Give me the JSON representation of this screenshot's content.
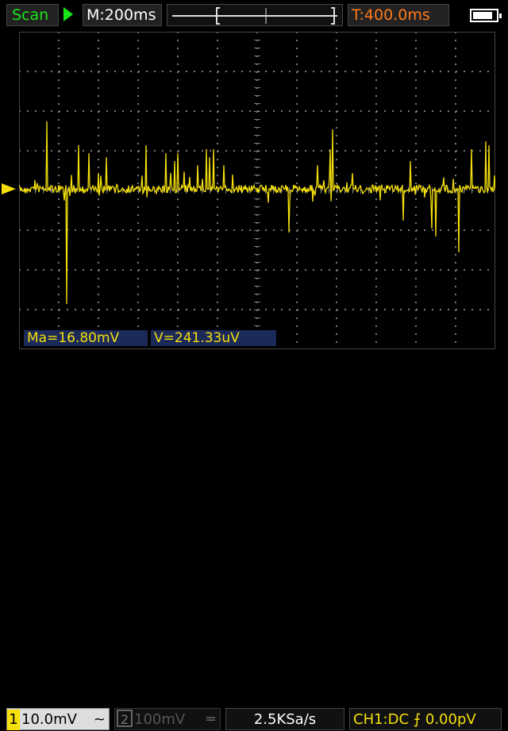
{
  "status_bar": {
    "mode": "Scan",
    "run_icon": "play-icon",
    "timebase": "M:200ms",
    "trigger_time": "T:400.0ms",
    "battery_icon": "battery-icon"
  },
  "colors": {
    "ch1": "#f5e00a",
    "run": "#19e619",
    "trigger_time": "#ff7a1a",
    "grid": "#7a7a7a"
  },
  "measurements": {
    "ma": "Ma=16.80mV",
    "v": "V=241.33uV"
  },
  "channels": {
    "ch1": {
      "number": "1",
      "scale": "10.0mV",
      "coupling": "~"
    },
    "ch2": {
      "number": "2",
      "scale": "100mV",
      "coupling": "═"
    }
  },
  "sample_rate": "2.5KSa/s",
  "trigger": "CH1:DC ⨍ 0.00pV"
}
